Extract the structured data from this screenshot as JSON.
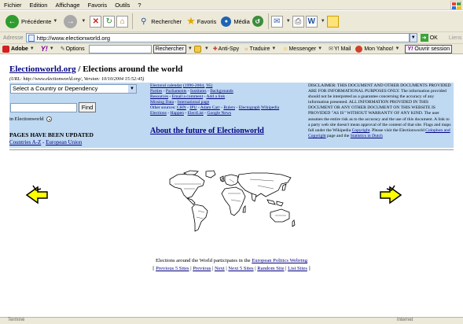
{
  "browser": {
    "menu": [
      "Fichier",
      "Edition",
      "Affichage",
      "Favoris",
      "Outils",
      "?"
    ],
    "toolbar": {
      "back_label": "Précédente",
      "search_label": "Rechercher",
      "favorites_label": "Favoris",
      "media_label": "Média"
    },
    "address": {
      "label": "Adresse",
      "url": "http://www.electionworld.org",
      "go_label": "OK",
      "links_label": "Liens"
    },
    "yahoo_bar": {
      "adobe_label": "Adobe",
      "yahoo_label": "Y!",
      "options_label": "Options",
      "search_button": "Rechercher",
      "antispy_label": "Anti-Spy",
      "translate_label": "Traduire",
      "messenger_label": "Messenger",
      "mail_label": "Y! Mail",
      "my_yahoo_label": "Mon Yahoo!",
      "open_session_label": "Ouvrir session"
    },
    "status": {
      "left": "Terminé",
      "right": "Internet"
    }
  },
  "page": {
    "site_link": "Electionworld.org",
    "title_rest": " / Elections around the world",
    "url_line": "(URL: http://www.electionworld.org/, Version: 10/10/2004 15:52:45)",
    "country_select": "Select a Country or Dependency",
    "find_button": "Find",
    "in_site_label": "in Electionworld",
    "updated_heading": "PAGES HAVE BEEN UPDATED",
    "updated_links": [
      "Countries A-Z",
      "European Union"
    ],
    "links_lines": [
      [
        "Electoral calendar",
        "(1996-2004,",
        "'05)"
      ],
      [
        "Parties",
        "Parliaments",
        "Institutes",
        "Backgrounds"
      ],
      [
        "Resources",
        "Email a comment",
        "Add a link"
      ],
      [
        "Missing Data",
        "International page"
      ],
      [
        "Other sources:",
        "CHN",
        "IPU",
        "Adam Carr",
        "Rulers",
        "Electograph",
        "Wikipedia"
      ],
      [
        "Elections",
        "Happen",
        "ElectList",
        "Google News"
      ]
    ],
    "future_link": "About the future of Electionworld",
    "disclaimer_text": "DISCLAIMER: THIS DOCUMENT AND OTHER DOCUMENTS PROVIDED ARE FOR INFORMATIONAL PURPOSES ONLY. The information provided should not be interpreted as a guarantee concerning the accuracy of any information presented. ALL INFORMATION PROVIDED IN THIS DOCUMENT OR ANY OTHER DOCUMENT ON THIS WEBSITE IS PROVIDED \"AS IS\" WITHOUT WARRANTY OF ANY KIND. The user assumes the entire risk as to the accuracy and the use of this document. A link to a party web site doesn't mean approval of the content of that site. Flags and maps fall under the Wikipedia",
    "disclaimer_link1": "Copyright",
    "disclaimer_mid": ". Please visit the Electionworld",
    "disclaimer_link2": "Colophon and Copyright",
    "disclaimer_end": "page and the",
    "disclaimer_link3": "Statistics in Dutch",
    "footer": {
      "line1_text": "Elections around the World participates in the",
      "line1_link": "European Politics Webring",
      "nav": [
        "Previous 5 Sites",
        "Previous",
        "Next",
        "Next 5 Sites",
        "Random Site",
        "List Sites"
      ]
    },
    "colors": {
      "band": "#bfd9f2",
      "link": "#000080",
      "arrow_fill": "#ffff00"
    }
  }
}
